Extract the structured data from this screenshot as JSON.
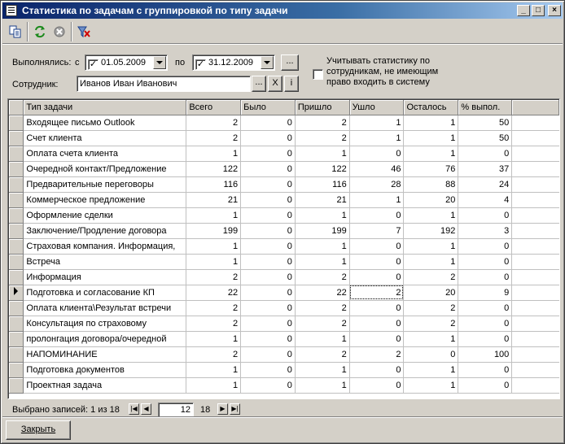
{
  "window": {
    "title": "Статистика по задачам с группировкой по типу задачи"
  },
  "toolbar": {
    "icons": [
      "copy-icon",
      "refresh-icon",
      "stop-icon",
      "clear-filter-icon"
    ]
  },
  "filters": {
    "executed_label": "Выполнялись:",
    "from_label": "с",
    "from_date": "01.05.2009",
    "from_checked": true,
    "to_label": "по",
    "to_date": "31.12.2009",
    "to_checked": true,
    "ellipsis": "...",
    "employee_label": "Сотрудник:",
    "employee_value": "Иванов Иван Иванович",
    "clear": "X",
    "info": "i",
    "stats_option_label": "Учитывать статистику по сотрудникам, не имеющим право входить в систему",
    "stats_option_checked": false
  },
  "grid": {
    "columns": [
      "Тип задачи",
      "Всего",
      "Было",
      "Пришло",
      "Ушло",
      "Осталось",
      "% выпол."
    ],
    "rows": [
      [
        "Входящее письмо Outlook",
        "2",
        "0",
        "2",
        "1",
        "1",
        "50"
      ],
      [
        "Счет клиента",
        "2",
        "0",
        "2",
        "1",
        "1",
        "50"
      ],
      [
        "Оплата счета клиента",
        "1",
        "0",
        "1",
        "0",
        "1",
        "0"
      ],
      [
        "Очередной контакт/Предложение",
        "122",
        "0",
        "122",
        "46",
        "76",
        "37"
      ],
      [
        "Предварительные переговоры",
        "116",
        "0",
        "116",
        "28",
        "88",
        "24"
      ],
      [
        "Коммерческое предложение",
        "21",
        "0",
        "21",
        "1",
        "20",
        "4"
      ],
      [
        "Оформление сделки",
        "1",
        "0",
        "1",
        "0",
        "1",
        "0"
      ],
      [
        "Заключение/Продление договора",
        "199",
        "0",
        "199",
        "7",
        "192",
        "3"
      ],
      [
        "Страховая компания. Информация,",
        "1",
        "0",
        "1",
        "0",
        "1",
        "0"
      ],
      [
        "Встреча",
        "1",
        "0",
        "1",
        "0",
        "1",
        "0"
      ],
      [
        "Информация",
        "2",
        "0",
        "2",
        "0",
        "2",
        "0"
      ],
      [
        "Подготовка и согласование КП",
        "22",
        "0",
        "22",
        "2",
        "20",
        "9"
      ],
      [
        "Оплата клиента\\Результат встречи",
        "2",
        "0",
        "2",
        "0",
        "2",
        "0"
      ],
      [
        "Консультация по страховому",
        "2",
        "0",
        "2",
        "0",
        "2",
        "0"
      ],
      [
        "пролонгация договора/очередной",
        "1",
        "0",
        "1",
        "0",
        "1",
        "0"
      ],
      [
        "НАПОМИНАНИЕ",
        "2",
        "0",
        "2",
        "2",
        "0",
        "100"
      ],
      [
        "Подготовка документов",
        "1",
        "0",
        "1",
        "0",
        "1",
        "0"
      ],
      [
        "Проектная задача",
        "1",
        "0",
        "1",
        "0",
        "1",
        "0"
      ]
    ],
    "current_row_index": 11
  },
  "navigator": {
    "status": "Выбрано записей: 1 из 18",
    "current": "12",
    "total": "18"
  },
  "footer": {
    "close_label": "Закрыть"
  }
}
